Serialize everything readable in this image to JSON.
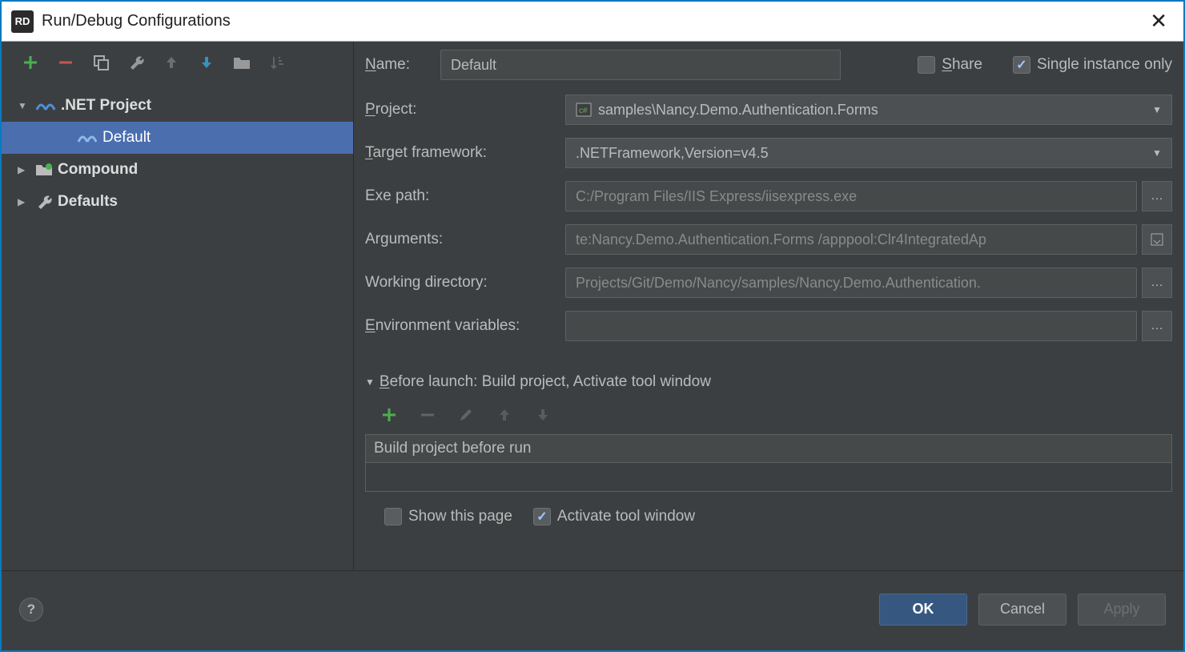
{
  "window": {
    "title": "Run/Debug Configurations",
    "app_icon_text": "RD"
  },
  "toolbar": {
    "add": "Add",
    "remove": "Remove",
    "copy": "Copy",
    "settings": "Settings",
    "up": "Up",
    "down": "Down",
    "folder": "Folder",
    "sort": "Sort"
  },
  "tree": {
    "items": [
      {
        "label": ".NET Project",
        "expanded": true,
        "bold": true,
        "icon": "dotnet"
      },
      {
        "label": "Default",
        "selected": true,
        "level": 2,
        "icon": "dotnet"
      },
      {
        "label": "Compound",
        "expanded": false,
        "bold": true,
        "icon": "folder"
      },
      {
        "label": "Defaults",
        "expanded": false,
        "bold": true,
        "icon": "wrench"
      }
    ]
  },
  "form": {
    "name_label": "Name:",
    "name_value": "Default",
    "share_label": "Share",
    "share_checked": false,
    "single_instance_label": "Single instance only",
    "single_instance_checked": true,
    "project_label": "Project:",
    "project_value": "samples\\Nancy.Demo.Authentication.Forms",
    "target_label": "Target framework:",
    "target_value": ".NETFramework,Version=v4.5",
    "exe_label": "Exe path:",
    "exe_value": "C:/Program Files/IIS Express/iisexpress.exe",
    "args_label": "Arguments:",
    "args_value": "te:Nancy.Demo.Authentication.Forms /apppool:Clr4IntegratedAp",
    "workdir_label": "Working directory:",
    "workdir_value": "Projects/Git/Demo/Nancy/samples/Nancy.Demo.Authentication.",
    "env_label": "Environment variables:",
    "env_value": ""
  },
  "before_launch": {
    "header": "Before launch: Build project, Activate tool window",
    "items": [
      "Build project before run"
    ],
    "show_page_label": "Show this page",
    "show_page_checked": false,
    "activate_label": "Activate tool window",
    "activate_checked": true
  },
  "footer": {
    "ok": "OK",
    "cancel": "Cancel",
    "apply": "Apply"
  }
}
